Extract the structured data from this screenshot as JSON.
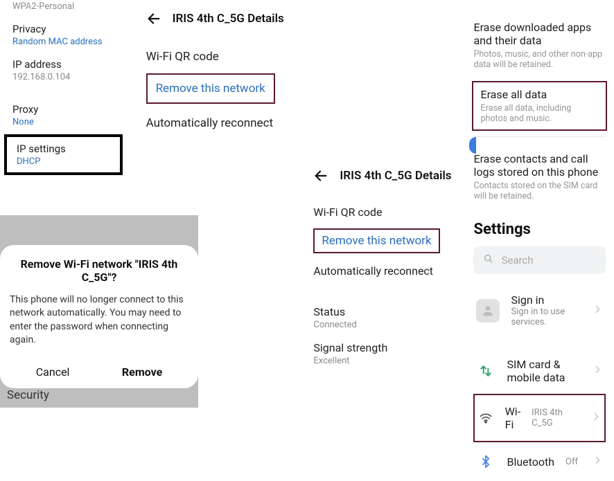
{
  "col1": {
    "wpa_label": "WPA2-Personal",
    "privacy": {
      "label": "Privacy",
      "value": "Random MAC address"
    },
    "ip": {
      "label": "IP address",
      "value": "192.168.0.104"
    },
    "proxy": {
      "label": "Proxy",
      "value": "None"
    },
    "ip_settings": {
      "label": "IP settings",
      "value": "DHCP"
    }
  },
  "dialog": {
    "title": "Remove Wi-Fi network \"IRIS 4th C_5G\"?",
    "body": "This phone will no longer connect to this network automatically. You may need to enter the password when connecting again.",
    "cancel": "Cancel",
    "remove": "Remove"
  },
  "security_strip": "Security",
  "details1": {
    "title": "IRIS 4th C_5G Details",
    "qr": "Wi-Fi QR code",
    "remove": "Remove this network",
    "auto": "Automatically reconnect"
  },
  "details2": {
    "title": "IRIS 4th C_5G Details",
    "qr": "Wi-Fi QR code",
    "remove": "Remove this network",
    "auto": "Automatically reconnect",
    "status_l": "Status",
    "status_v": "Connected",
    "signal_l": "Signal strength",
    "signal_v": "Excellent"
  },
  "reset": {
    "erase_apps_t": "Erase downloaded apps and their data",
    "erase_apps_s": "Photos, music, and other non-app data will be retained.",
    "erase_all_t": "Erase all data",
    "erase_all_s": "Erase all data, including photos and music.",
    "erase_sim_t": "Erase contacts and call logs stored on this phone",
    "erase_sim_s": "Contacts stored on the SIM card will be retained."
  },
  "settings": {
    "heading": "Settings",
    "search_ph": "Search",
    "signin_l": "Sign in",
    "signin_s": "Sign in to use services.",
    "sim_l": "SIM card & mobile data",
    "wifi_l": "Wi-Fi",
    "wifi_v": "IRIS 4th C_5G",
    "bt_l": "Bluetooth",
    "bt_v": "Off"
  }
}
